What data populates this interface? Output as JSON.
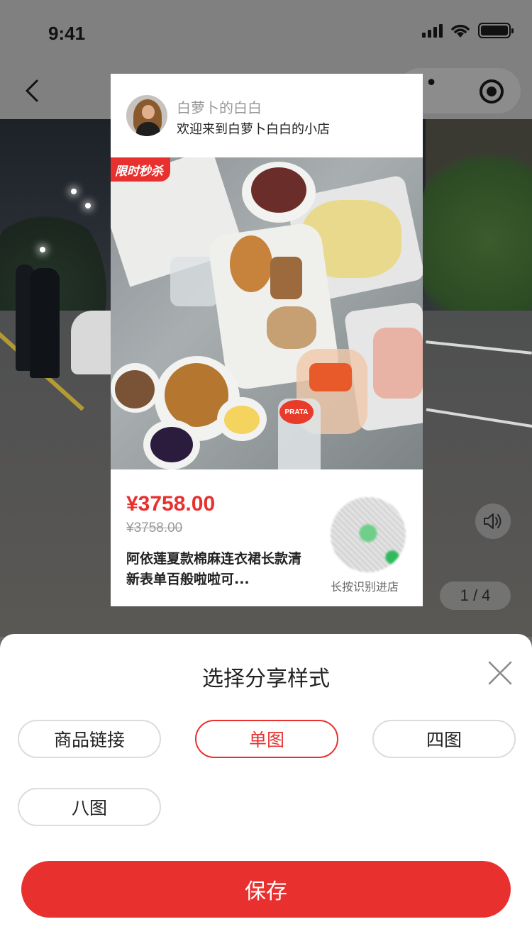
{
  "status_bar": {
    "time": "9:41"
  },
  "poster": {
    "shop_name": "白萝卜的白白",
    "welcome": "欢迎来到白萝卜白白的小店",
    "badge": "限时秒杀",
    "bottle_label": "PRATA",
    "price": "¥3758.00",
    "original_price": "¥3758.00",
    "product_title": "阿依莲夏款棉麻连衣裙长款清新表单百般啦啦可...",
    "qr_caption": "长按识别进店"
  },
  "media": {
    "page_indicator": "1 / 4"
  },
  "share_sheet": {
    "title": "选择分享样式",
    "options": [
      {
        "label": "商品链接",
        "selected": false
      },
      {
        "label": "单图",
        "selected": true
      },
      {
        "label": "四图",
        "selected": false
      },
      {
        "label": "八图",
        "selected": false
      }
    ],
    "save_label": "保存"
  },
  "colors": {
    "accent": "#e8312f",
    "text": "#222222",
    "muted": "#999999"
  },
  "icons": [
    "back-icon",
    "more-icon",
    "close-mini-program-icon",
    "volume-icon",
    "close-icon",
    "signal-icon",
    "wifi-icon",
    "battery-icon"
  ]
}
